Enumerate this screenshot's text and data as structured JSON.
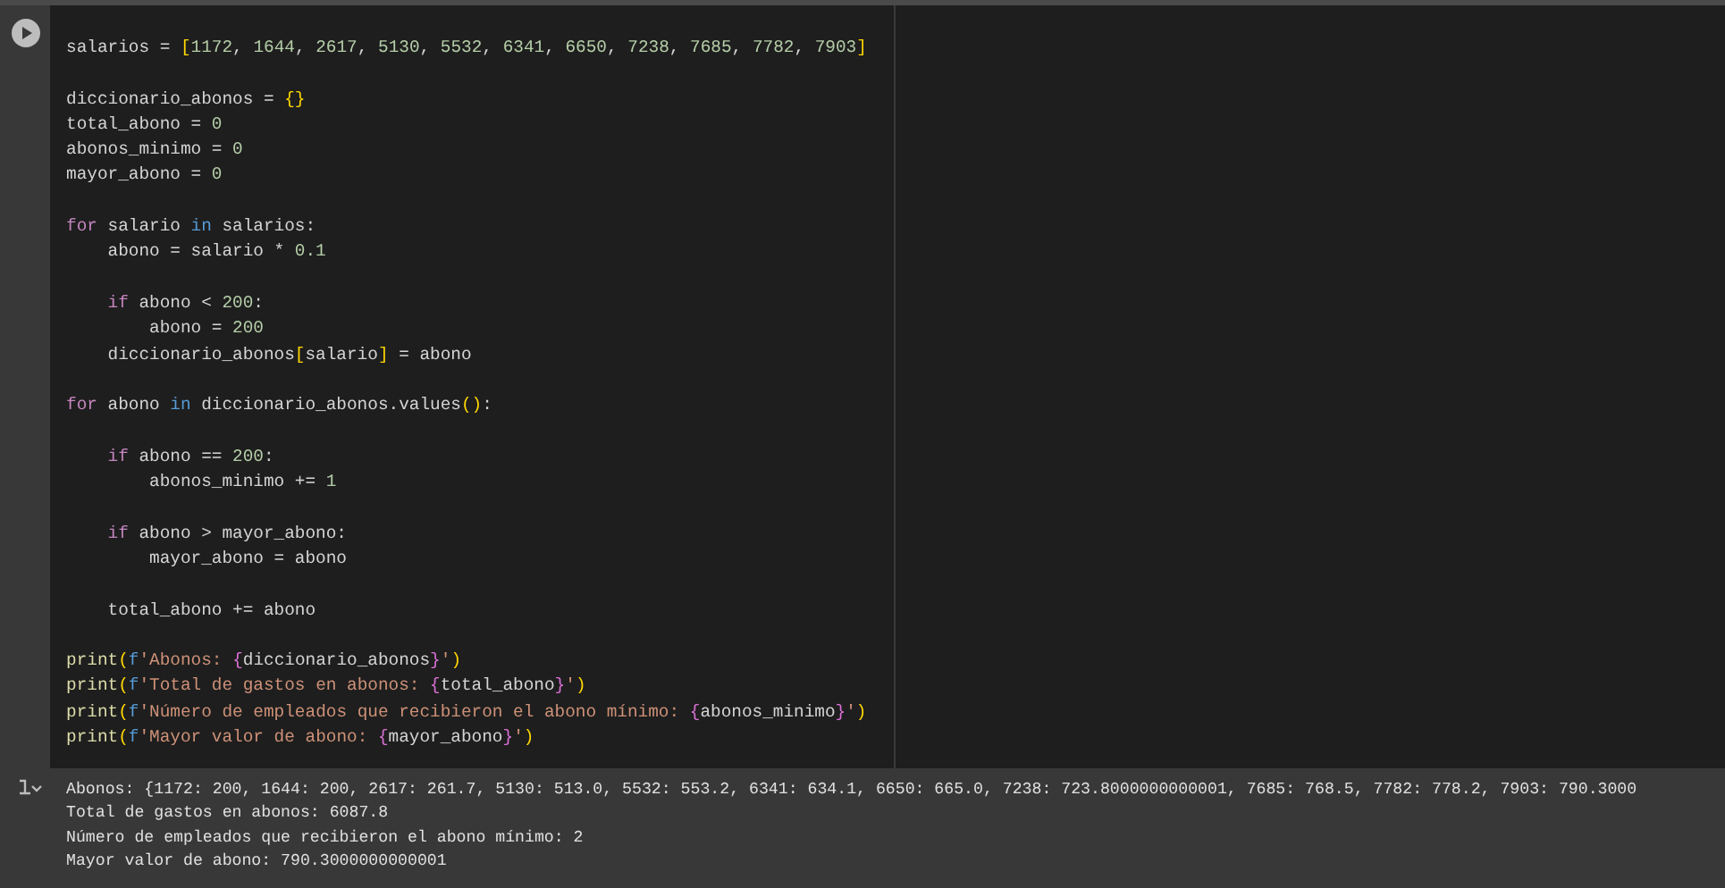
{
  "cell": {
    "lines": [
      {
        "kind": "code",
        "tokens": [
          {
            "text": "salarios = ",
            "kind": "plain"
          },
          {
            "text": "[",
            "kind": "bracket"
          },
          {
            "text": "1172",
            "kind": "number"
          },
          {
            "text": ", ",
            "kind": "plain"
          },
          {
            "text": "1644",
            "kind": "number"
          },
          {
            "text": ", ",
            "kind": "plain"
          },
          {
            "text": "2617",
            "kind": "number"
          },
          {
            "text": ", ",
            "kind": "plain"
          },
          {
            "text": "5130",
            "kind": "number"
          },
          {
            "text": ", ",
            "kind": "plain"
          },
          {
            "text": "5532",
            "kind": "number"
          },
          {
            "text": ", ",
            "kind": "plain"
          },
          {
            "text": "6341",
            "kind": "number"
          },
          {
            "text": ", ",
            "kind": "plain"
          },
          {
            "text": "6650",
            "kind": "number"
          },
          {
            "text": ", ",
            "kind": "plain"
          },
          {
            "text": "7238",
            "kind": "number"
          },
          {
            "text": ", ",
            "kind": "plain"
          },
          {
            "text": "7685",
            "kind": "number"
          },
          {
            "text": ", ",
            "kind": "plain"
          },
          {
            "text": "7782",
            "kind": "number"
          },
          {
            "text": ", ",
            "kind": "plain"
          },
          {
            "text": "7903",
            "kind": "number"
          },
          {
            "text": "]",
            "kind": "bracket"
          }
        ]
      },
      {
        "kind": "blank"
      },
      {
        "kind": "code",
        "tokens": [
          {
            "text": "diccionario_abonos = ",
            "kind": "plain"
          },
          {
            "text": "{}",
            "kind": "bracket"
          }
        ]
      },
      {
        "kind": "code",
        "tokens": [
          {
            "text": "total_abono = ",
            "kind": "plain"
          },
          {
            "text": "0",
            "kind": "number"
          }
        ]
      },
      {
        "kind": "code",
        "tokens": [
          {
            "text": "abonos_minimo = ",
            "kind": "plain"
          },
          {
            "text": "0",
            "kind": "number"
          }
        ]
      },
      {
        "kind": "code",
        "tokens": [
          {
            "text": "mayor_abono = ",
            "kind": "plain"
          },
          {
            "text": "0",
            "kind": "number"
          }
        ]
      },
      {
        "kind": "blank"
      },
      {
        "kind": "code",
        "tokens": [
          {
            "text": "for",
            "kind": "keyword"
          },
          {
            "text": " salario ",
            "kind": "plain"
          },
          {
            "text": "in",
            "kind": "operator"
          },
          {
            "text": " salarios:",
            "kind": "plain"
          }
        ]
      },
      {
        "kind": "code",
        "tokens": [
          {
            "text": "    abono = salario * ",
            "kind": "plain"
          },
          {
            "text": "0.1",
            "kind": "number"
          }
        ]
      },
      {
        "kind": "blank"
      },
      {
        "kind": "code",
        "tokens": [
          {
            "text": "    if",
            "kind": "keyword"
          },
          {
            "text": " abono < ",
            "kind": "plain"
          },
          {
            "text": "200",
            "kind": "number"
          },
          {
            "text": ":",
            "kind": "plain"
          }
        ]
      },
      {
        "kind": "code",
        "tokens": [
          {
            "text": "        abono = ",
            "kind": "plain"
          },
          {
            "text": "200",
            "kind": "number"
          }
        ]
      },
      {
        "kind": "code",
        "tokens": [
          {
            "text": "    diccionario_abonos",
            "kind": "plain"
          },
          {
            "text": "[",
            "kind": "bracket"
          },
          {
            "text": "salario",
            "kind": "plain"
          },
          {
            "text": "]",
            "kind": "bracket"
          },
          {
            "text": " = abono",
            "kind": "plain"
          }
        ]
      },
      {
        "kind": "blank"
      },
      {
        "kind": "code",
        "tokens": [
          {
            "text": "for",
            "kind": "keyword"
          },
          {
            "text": " abono ",
            "kind": "plain"
          },
          {
            "text": "in",
            "kind": "operator"
          },
          {
            "text": " diccionario_abonos.values",
            "kind": "plain"
          },
          {
            "text": "()",
            "kind": "bracket"
          },
          {
            "text": ":",
            "kind": "plain"
          }
        ]
      },
      {
        "kind": "blank"
      },
      {
        "kind": "code",
        "tokens": [
          {
            "text": "    if",
            "kind": "keyword"
          },
          {
            "text": " abono == ",
            "kind": "plain"
          },
          {
            "text": "200",
            "kind": "number"
          },
          {
            "text": ":",
            "kind": "plain"
          }
        ]
      },
      {
        "kind": "code",
        "tokens": [
          {
            "text": "        abonos_minimo += ",
            "kind": "plain"
          },
          {
            "text": "1",
            "kind": "number"
          }
        ]
      },
      {
        "kind": "blank"
      },
      {
        "kind": "code",
        "tokens": [
          {
            "text": "    if",
            "kind": "keyword"
          },
          {
            "text": " abono > mayor_abono:",
            "kind": "plain"
          }
        ]
      },
      {
        "kind": "code",
        "tokens": [
          {
            "text": "        mayor_abono = abono",
            "kind": "plain"
          }
        ]
      },
      {
        "kind": "blank"
      },
      {
        "kind": "code",
        "tokens": [
          {
            "text": "    total_abono += abono",
            "kind": "plain"
          }
        ]
      },
      {
        "kind": "blank"
      },
      {
        "kind": "code",
        "tokens": [
          {
            "text": "print",
            "kind": "function"
          },
          {
            "text": "(",
            "kind": "bracket"
          },
          {
            "text": "f",
            "kind": "prefix"
          },
          {
            "text": "'Abonos: ",
            "kind": "string"
          },
          {
            "text": "{",
            "kind": "interp"
          },
          {
            "text": "diccionario_abonos",
            "kind": "plain"
          },
          {
            "text": "}",
            "kind": "interp"
          },
          {
            "text": "'",
            "kind": "string"
          },
          {
            "text": ")",
            "kind": "bracket"
          }
        ]
      },
      {
        "kind": "code",
        "tokens": [
          {
            "text": "print",
            "kind": "function"
          },
          {
            "text": "(",
            "kind": "bracket"
          },
          {
            "text": "f",
            "kind": "prefix"
          },
          {
            "text": "'Total de gastos en abonos: ",
            "kind": "string"
          },
          {
            "text": "{",
            "kind": "interp"
          },
          {
            "text": "total_abono",
            "kind": "plain"
          },
          {
            "text": "}",
            "kind": "interp"
          },
          {
            "text": "'",
            "kind": "string"
          },
          {
            "text": ")",
            "kind": "bracket"
          }
        ]
      },
      {
        "kind": "code",
        "tokens": [
          {
            "text": "print",
            "kind": "function"
          },
          {
            "text": "(",
            "kind": "bracket"
          },
          {
            "text": "f",
            "kind": "prefix"
          },
          {
            "text": "'Número de empleados que recibieron el abono mínimo: ",
            "kind": "string"
          },
          {
            "text": "{",
            "kind": "interp"
          },
          {
            "text": "abonos_minimo",
            "kind": "plain"
          },
          {
            "text": "}",
            "kind": "interp"
          },
          {
            "text": "'",
            "kind": "string"
          },
          {
            "text": ")",
            "kind": "bracket"
          }
        ]
      },
      {
        "kind": "code",
        "tokens": [
          {
            "text": "print",
            "kind": "function"
          },
          {
            "text": "(",
            "kind": "bracket"
          },
          {
            "text": "f",
            "kind": "prefix"
          },
          {
            "text": "'Mayor valor de abono: ",
            "kind": "string"
          },
          {
            "text": "{",
            "kind": "interp"
          },
          {
            "text": "mayor_abono",
            "kind": "plain"
          },
          {
            "text": "}",
            "kind": "interp"
          },
          {
            "text": "'",
            "kind": "string"
          },
          {
            "text": ")",
            "kind": "bracket"
          }
        ]
      }
    ]
  },
  "output": {
    "lines": [
      "Abonos: {1172: 200, 1644: 200, 2617: 261.7, 5130: 513.0, 5532: 553.2, 6341: 634.1, 6650: 665.0, 7238: 723.8000000000001, 7685: 768.5, 7782: 778.2, 7903: 790.3000",
      "Total de gastos en abonos: 6087.8",
      "Número de empleados que recibieron el abono mínimo: 2",
      "Mayor valor de abono: 790.3000000000001"
    ]
  }
}
